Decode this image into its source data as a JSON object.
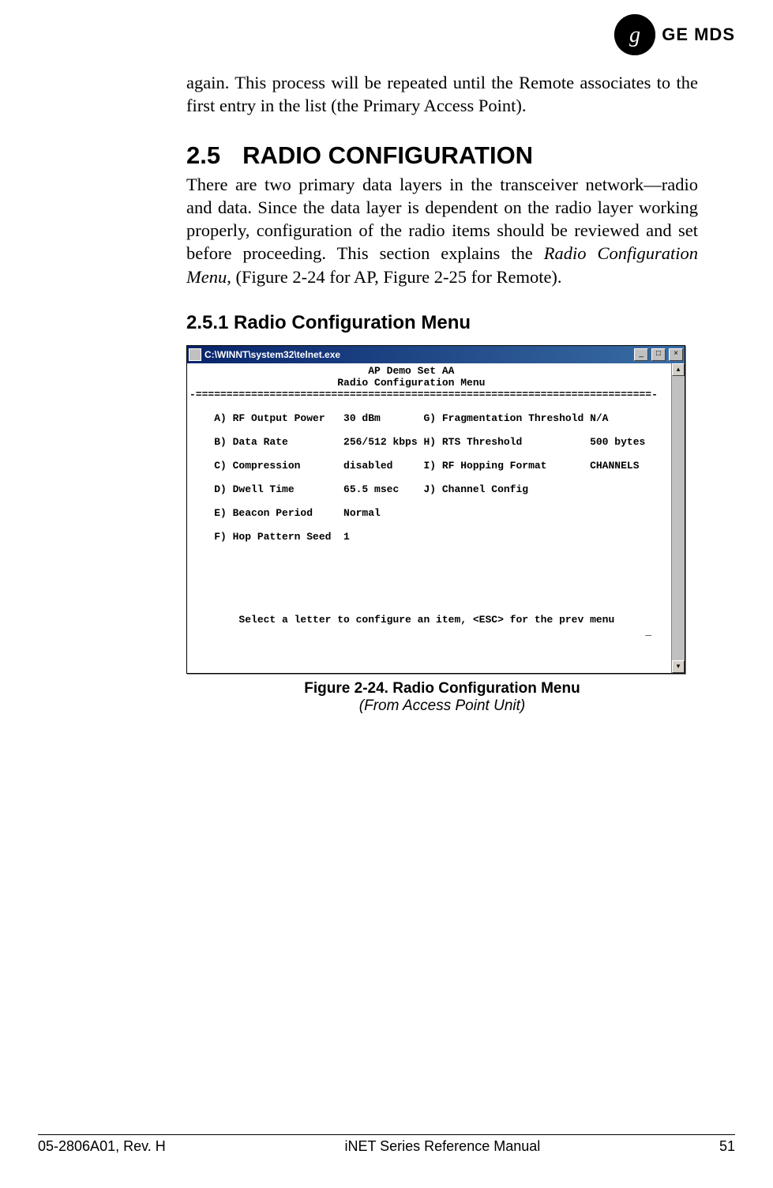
{
  "logo": {
    "monogram": "⅊",
    "brand": "GE MDS"
  },
  "para_intro": "again. This process will be repeated until the Remote associates to the first entry in the list (the Primary Access Point).",
  "section": {
    "num": "2.5",
    "title": "RADIO CONFIGURATION"
  },
  "para_section_a": "There are two primary data layers in the transceiver network—radio and data. Since the data layer is dependent on the radio layer working prop­erly, configuration of the radio items should be reviewed and set before proceeding. This section explains the ",
  "para_section_ital": "Radio Configuration Menu",
  "para_section_b": ", (Figure 2-24 for AP, Figure 2-25 for Remote).",
  "subsection": "2.5.1 Radio Configuration Menu",
  "window": {
    "title": "C:\\WINNT\\system32\\telnet.exe",
    "btn_min": "_",
    "btn_max": "□",
    "btn_close": "×",
    "scroll_up": "▴",
    "scroll_down": "▾",
    "term_lines": "                             AP Demo Set AA\n                        Radio Configuration Menu\n-==========================================================================-\n\n    A) RF Output Power   30 dBm       G) Fragmentation Threshold N/A\n\n    B) Data Rate         256/512 kbps H) RTS Threshold           500 bytes\n\n    C) Compression       disabled     I) RF Hopping Format       CHANNELS\n\n    D) Dwell Time        65.5 msec    J) Channel Config\n\n    E) Beacon Period     Normal\n\n    F) Hop Pattern Seed  1\n\n\n\n\n\n\n        Select a letter to configure an item, <ESC> for the prev menu\n                                                                          _"
  },
  "caption": {
    "bold": "Figure 2-24. Radio Configuration Menu",
    "ital": "(From Access Point Unit)"
  },
  "footer": {
    "left": "05-2806A01, Rev. H",
    "center": "iNET Series Reference Manual",
    "right": "51"
  }
}
